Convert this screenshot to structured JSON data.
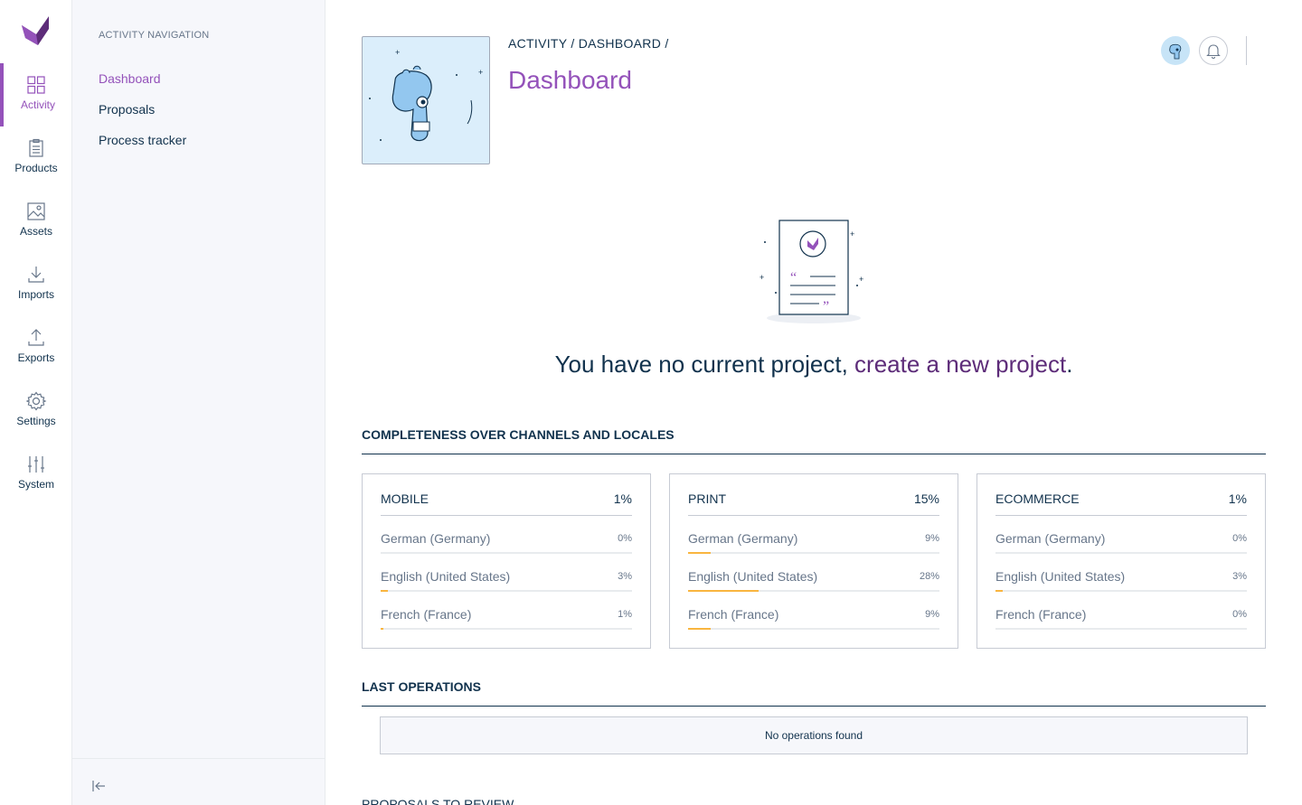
{
  "brand": {
    "accent": "#9452ba",
    "accent_dark": "#5d2c79",
    "progress_color": "#f9b53f",
    "logo": "akeneo-logo"
  },
  "main_nav": [
    {
      "label": "Activity",
      "icon": "activity-icon",
      "active": true
    },
    {
      "label": "Products",
      "icon": "products-icon",
      "active": false
    },
    {
      "label": "Assets",
      "icon": "assets-icon",
      "active": false
    },
    {
      "label": "Imports",
      "icon": "imports-icon",
      "active": false
    },
    {
      "label": "Exports",
      "icon": "exports-icon",
      "active": false
    },
    {
      "label": "Settings",
      "icon": "settings-icon",
      "active": false
    },
    {
      "label": "System",
      "icon": "system-icon",
      "active": false
    }
  ],
  "sub_nav": {
    "title": "Activity navigation",
    "items": [
      {
        "label": "Dashboard",
        "active": true
      },
      {
        "label": "Proposals",
        "active": false
      },
      {
        "label": "Process tracker",
        "active": false
      }
    ],
    "collapse_icon": "collapse-left-icon"
  },
  "header": {
    "breadcrumb_activity": "Activity",
    "breadcrumb_sep1": " / ",
    "breadcrumb_dashboard": "Dashboard",
    "breadcrumb_sep2": " /",
    "title": "Dashboard"
  },
  "empty_state": {
    "text": "You have no current project, ",
    "link": "create a new project",
    "suffix": "."
  },
  "completeness": {
    "title": "Completeness over channels and locales",
    "channels": [
      {
        "name": "Mobile",
        "total": "1%",
        "locales": [
          {
            "name": "German (Germany)",
            "value": "0%",
            "fraction": 0.0
          },
          {
            "name": "English (United States)",
            "value": "3%",
            "fraction": 0.03
          },
          {
            "name": "French (France)",
            "value": "1%",
            "fraction": 0.01
          }
        ]
      },
      {
        "name": "Print",
        "total": "15%",
        "locales": [
          {
            "name": "German (Germany)",
            "value": "9%",
            "fraction": 0.09
          },
          {
            "name": "English (United States)",
            "value": "28%",
            "fraction": 0.28
          },
          {
            "name": "French (France)",
            "value": "9%",
            "fraction": 0.09
          }
        ]
      },
      {
        "name": "Ecommerce",
        "total": "1%",
        "locales": [
          {
            "name": "German (Germany)",
            "value": "0%",
            "fraction": 0.0
          },
          {
            "name": "English (United States)",
            "value": "3%",
            "fraction": 0.03
          },
          {
            "name": "French (France)",
            "value": "0%",
            "fraction": 0.0
          }
        ]
      }
    ]
  },
  "last_operations": {
    "title": "Last operations",
    "empty": "No operations found"
  },
  "next_section": {
    "title": "Proposals to review"
  }
}
